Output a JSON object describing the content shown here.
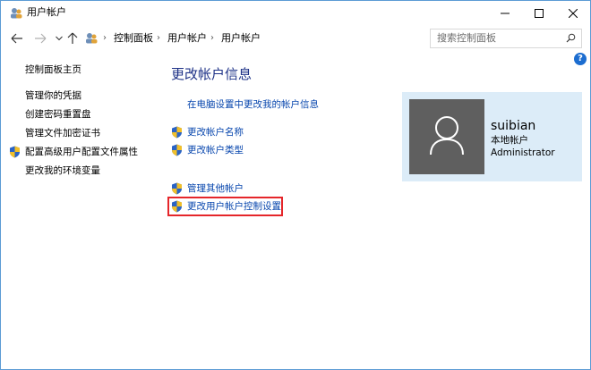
{
  "window": {
    "title": "用户帐户",
    "minimize_icon": "minimize-icon",
    "maximize_icon": "maximize-icon",
    "close_icon": "close-icon"
  },
  "address": {
    "breadcrumbs": [
      "控制面板",
      "用户帐户",
      "用户帐户"
    ],
    "search_placeholder": "搜索控制面板"
  },
  "sidebar": {
    "items": [
      {
        "label": "控制面板主页",
        "shield": false
      },
      {
        "label": "管理你的凭据",
        "shield": false
      },
      {
        "label": "创建密码重置盘",
        "shield": false
      },
      {
        "label": "管理文件加密证书",
        "shield": false
      },
      {
        "label": "配置高级用户配置文件属性",
        "shield": true
      },
      {
        "label": "更改我的环境变量",
        "shield": false
      }
    ]
  },
  "main": {
    "title": "更改帐户信息",
    "pc_settings_link": "在电脑设置中更改我的帐户信息",
    "change_name": "更改帐户名称",
    "change_type": "更改帐户类型",
    "manage_other": "管理其他帐户",
    "uac_settings": "更改用户帐户控制设置"
  },
  "account": {
    "name": "suibian",
    "type": "本地帐户",
    "role": "Administrator"
  },
  "colors": {
    "link": "#0645ad",
    "heading": "#1e3287",
    "card_bg": "#dcecf8",
    "avatar_bg": "#5f5f5f",
    "highlight": "#e5262a",
    "help": "#1c6dd0"
  }
}
